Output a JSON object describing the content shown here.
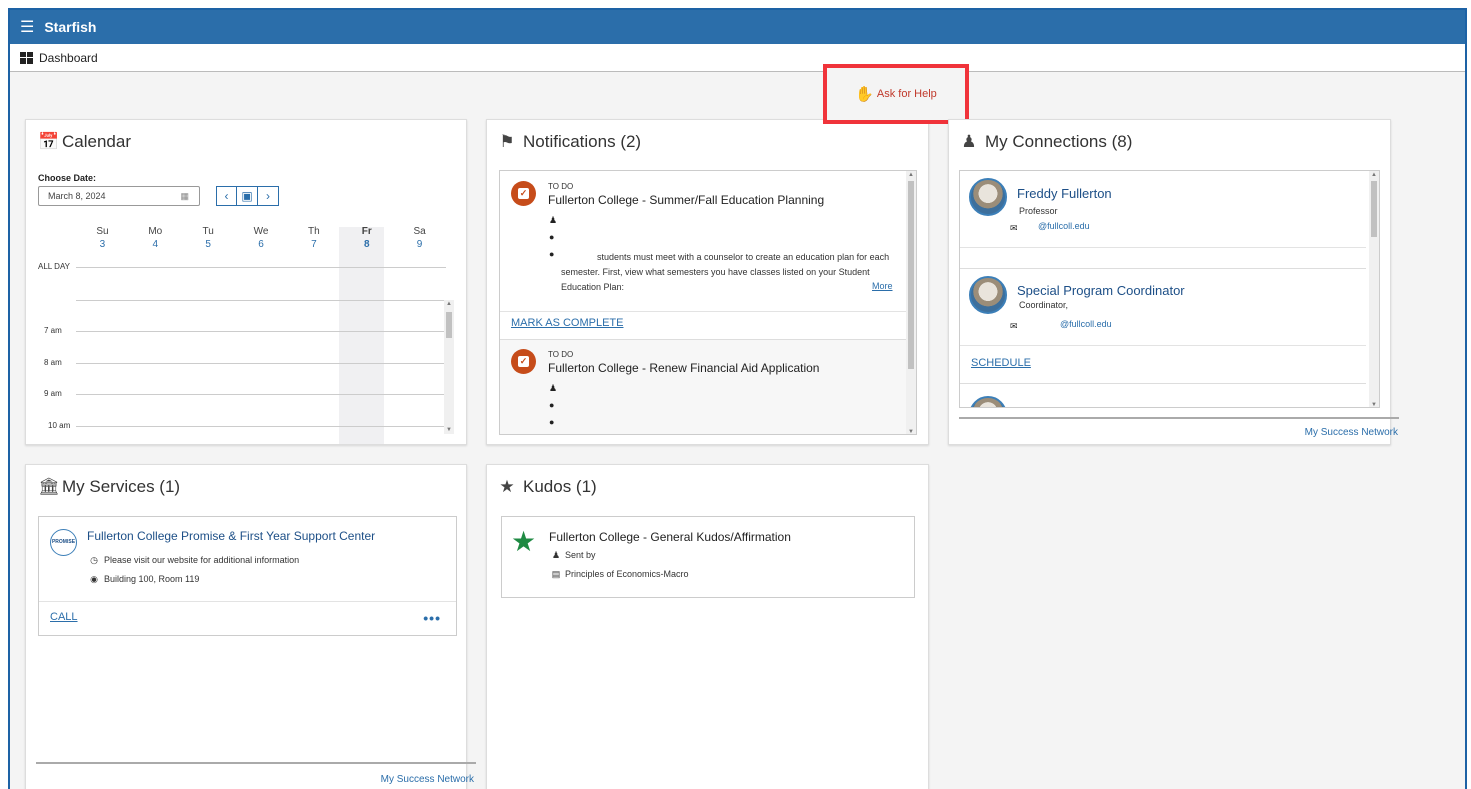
{
  "app": {
    "title": "Starfish",
    "breadcrumb": "Dashboard"
  },
  "help": {
    "label": "Ask for Help"
  },
  "calendar": {
    "title": "Calendar",
    "choose_label": "Choose Date:",
    "date_value": "March 8, 2024",
    "days": [
      {
        "abbr": "Su",
        "num": "3"
      },
      {
        "abbr": "Mo",
        "num": "4"
      },
      {
        "abbr": "Tu",
        "num": "5"
      },
      {
        "abbr": "We",
        "num": "6"
      },
      {
        "abbr": "Th",
        "num": "7"
      },
      {
        "abbr": "Fr",
        "num": "8"
      },
      {
        "abbr": "Sa",
        "num": "9"
      }
    ],
    "allday": "ALL DAY",
    "hours": [
      "7 am",
      "8 am",
      "9 am",
      "10 am"
    ]
  },
  "notifications": {
    "title": "Notifications (2)",
    "items": [
      {
        "type": "TO DO",
        "title": "Fullerton College - Summer/Fall Education Planning",
        "desc": "students must meet with a counselor to create an education plan for each semester. First, view what semesters you have classes listed on your Student Education Plan:",
        "more": "More",
        "action": "MARK AS COMPLETE"
      },
      {
        "type": "TO DO",
        "title": "Fullerton College - Renew Financial Aid Application"
      }
    ]
  },
  "connections": {
    "title": "My Connections (8)",
    "people": [
      {
        "name": "Freddy Fullerton",
        "role": "Professor",
        "email": "@fullcoll.edu"
      },
      {
        "name": "Special Program Coordinator",
        "role": "Coordinator,",
        "email": "@fullcoll.edu",
        "action": "SCHEDULE"
      }
    ],
    "footer": "My Success Network"
  },
  "services": {
    "title": "My Services (1)",
    "logo_text": "PROMISE",
    "name": "Fullerton College Promise & First Year Support Center",
    "info": "Please visit our website for additional information",
    "location": "Building 100, Room 119",
    "action": "CALL",
    "more": "•••",
    "footer": "My Success Network"
  },
  "kudos": {
    "title": "Kudos (1)",
    "item_title": "Fullerton College - General Kudos/Affirmation",
    "sent_by": "Sent by",
    "course": "Principles of Economics-Macro"
  },
  "colors": {
    "brand": "#2b6eaa",
    "accent_orange": "#c64c1a",
    "kudos_green": "#1f8a43",
    "highlight_red": "#f0333a"
  }
}
